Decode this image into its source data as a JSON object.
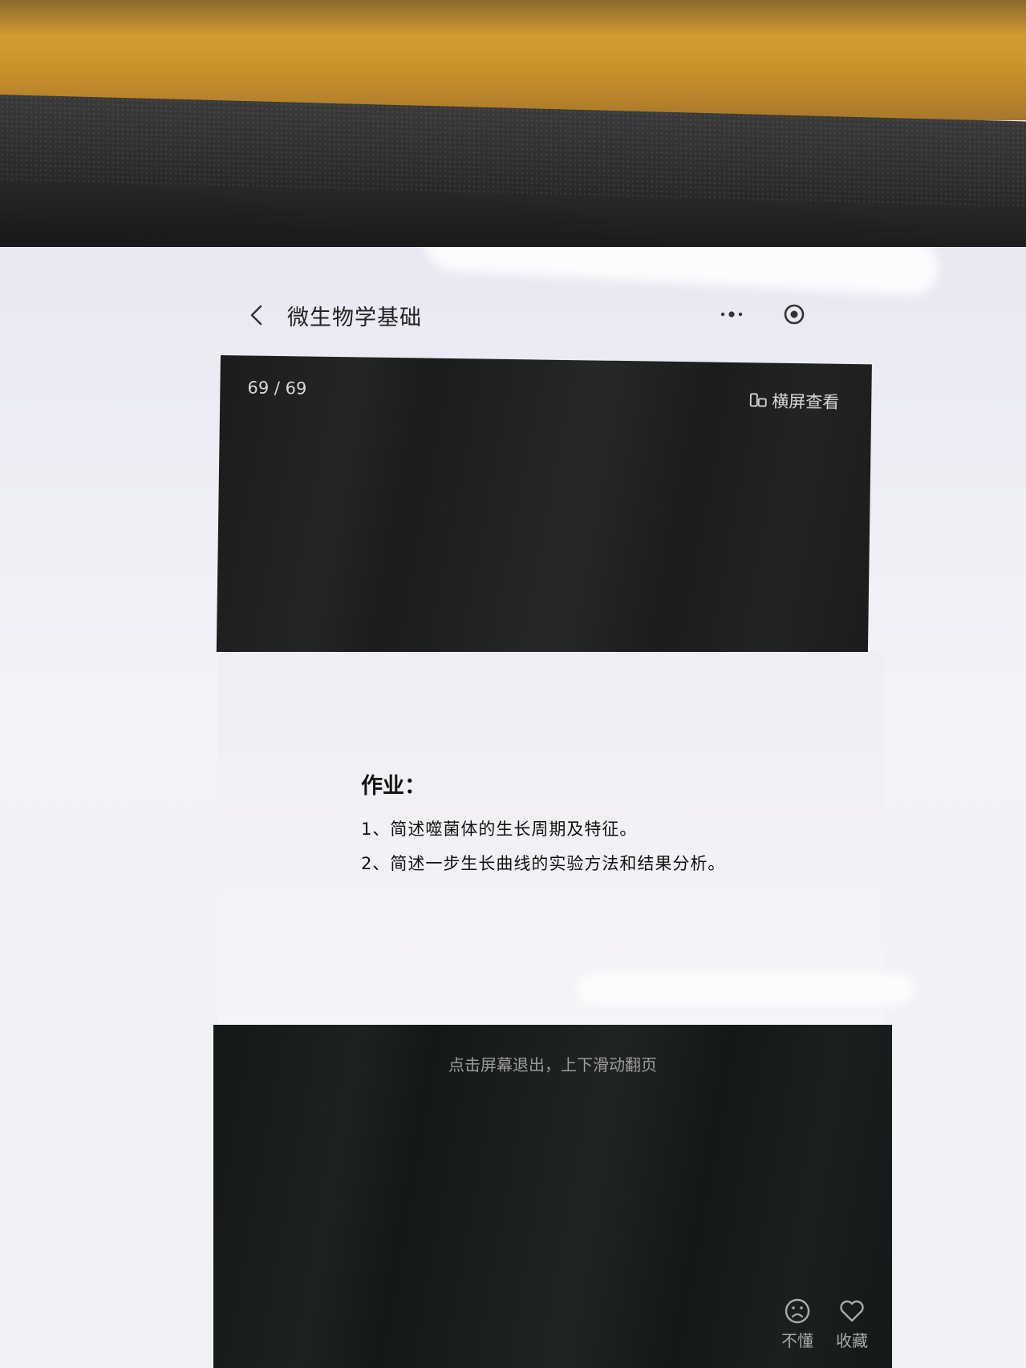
{
  "header": {
    "title": "微生物学基础"
  },
  "slide": {
    "page_counter": "69 / 69",
    "landscape_label": "横屏查看"
  },
  "homework": {
    "title": "作业：",
    "items": [
      "1、简述噬菌体的生长周期及特征。",
      "2、简述一步生长曲线的实验方法和结果分析。"
    ]
  },
  "viewer": {
    "hint": "点击屏幕退出，上下滑动翻页",
    "actions": [
      {
        "label": "不懂",
        "icon": "sad-face-icon"
      },
      {
        "label": "收藏",
        "icon": "heart-icon"
      }
    ]
  }
}
